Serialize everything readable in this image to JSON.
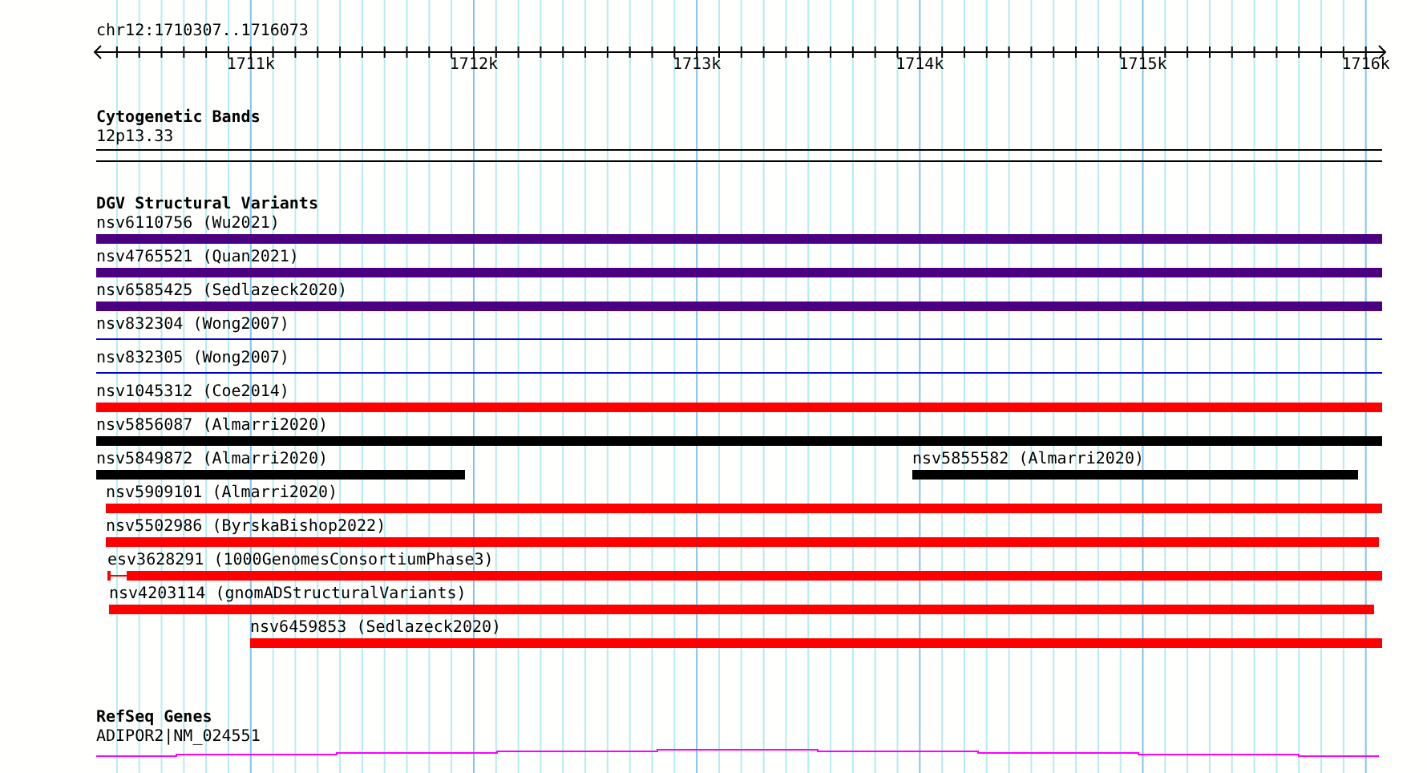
{
  "locus": "chr12:1710307..1716073",
  "axis": {
    "ticks": [
      "1711k",
      "1712k",
      "1713k",
      "1714k",
      "1715k",
      "1716k"
    ]
  },
  "cytobands": {
    "title": "Cytogenetic Bands",
    "band": "12p13.33"
  },
  "variants": {
    "title": "DGV Structural Variants",
    "rows": [
      [
        {
          "label": "nsv6110756 (Wu2021)",
          "color": "#4b0082",
          "kind": "bar"
        }
      ],
      [
        {
          "label": "nsv4765521 (Quan2021)",
          "color": "#4b0082",
          "kind": "bar"
        }
      ],
      [
        {
          "label": "nsv6585425 (Sedlazeck2020)",
          "color": "#4b0082",
          "kind": "bar"
        }
      ],
      [
        {
          "label": "nsv832304 (Wong2007)",
          "color": "#0000cc",
          "kind": "line"
        }
      ],
      [
        {
          "label": "nsv832305 (Wong2007)",
          "color": "#0000cc",
          "kind": "line"
        }
      ],
      [
        {
          "label": "nsv1045312 (Coe2014)",
          "color": "#ff0000",
          "kind": "bar"
        }
      ],
      [
        {
          "label": "nsv5856087 (Almarri2020)",
          "color": "#000000",
          "kind": "bar"
        }
      ],
      [
        {
          "label": "nsv5849872 (Almarri2020)",
          "color": "#000000",
          "kind": "bar"
        },
        {
          "label": "nsv5855582 (Almarri2020)",
          "color": "#000000",
          "kind": "bar"
        }
      ],
      [
        {
          "label": "nsv5909101 (Almarri2020)",
          "color": "#ff0000",
          "kind": "bar"
        }
      ],
      [
        {
          "label": "nsv5502986 (ByrskaBishop2022)",
          "color": "#ff0000",
          "kind": "bar"
        }
      ],
      [
        {
          "label": "esv3628291 (1000GenomesConsortiumPhase3)",
          "color": "#ff0000",
          "kind": "split"
        }
      ],
      [
        {
          "label": "nsv4203114 (gnomADStructuralVariants)",
          "color": "#ff0000",
          "kind": "bar"
        }
      ],
      [
        {
          "label": "nsv6459853 (Sedlazeck2020)",
          "color": "#ff0000",
          "kind": "bar"
        }
      ]
    ]
  },
  "genes": {
    "title": "RefSeq Genes",
    "items": [
      {
        "label": "ADIPOR2|NM_024551",
        "color": "#ff00ff"
      }
    ]
  }
}
